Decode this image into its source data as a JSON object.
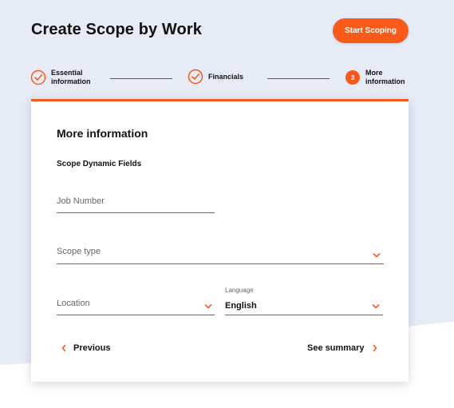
{
  "header": {
    "title": "Create Scope by Work",
    "start_button": "Start Scoping"
  },
  "stepper": {
    "steps": [
      {
        "label_line1": "Essential",
        "label_line2": "information",
        "state": "done",
        "icon": "check-circle-icon"
      },
      {
        "label_line1": "Financials",
        "label_line2": "",
        "state": "done",
        "icon": "check-circle-icon"
      },
      {
        "label_line1": "More",
        "label_line2": "information",
        "state": "active",
        "number": "3"
      }
    ]
  },
  "form": {
    "title": "More information",
    "section_title": "Scope Dynamic Fields",
    "job_number": {
      "placeholder": "Job Number",
      "value": ""
    },
    "scope_type": {
      "placeholder": "Scope type",
      "value": ""
    },
    "location": {
      "placeholder": "Location",
      "value": ""
    },
    "language": {
      "label": "Language",
      "value": "English"
    }
  },
  "nav": {
    "previous": "Previous",
    "summary": "See summary"
  },
  "colors": {
    "accent": "#fa5a19",
    "background": "#e7ebf6"
  }
}
